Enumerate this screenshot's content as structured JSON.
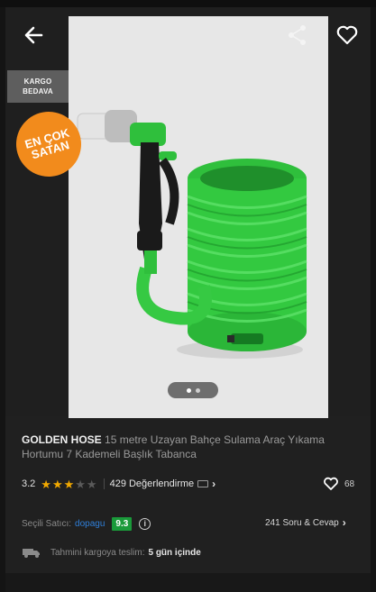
{
  "badges": {
    "kargo_line1": "KARGO",
    "kargo_line2": "BEDAVA",
    "bestseller_line1": "EN ÇOK",
    "bestseller_line2": "SATAN"
  },
  "gallery": {
    "page_count": 2,
    "active_index": 0
  },
  "product": {
    "brand": "GOLDEN HOSE",
    "name": "15 metre Uzayan Bahçe Sulama Araç Yıkama Hortumu 7 Kademeli Başlık Tabanca"
  },
  "rating": {
    "score": "3.2",
    "stars_filled": 3,
    "stars_total": 5,
    "reviews_label": "429 Değerlendirme"
  },
  "favorites": {
    "count": "68"
  },
  "seller": {
    "label": "Seçili Satıcı:",
    "name": "dopagu",
    "score": "9.3"
  },
  "qa": {
    "label": "241 Soru & Cevap"
  },
  "shipping": {
    "label": "Tahmini kargoya teslim:",
    "value": "5 gün içinde"
  },
  "colors": {
    "background": "#141414",
    "accent_orange": "#f28b1c",
    "star": "#f2a900",
    "seller_link": "#2f7fd9",
    "seller_score_bg": "#1a9a3a",
    "hose_green": "#3fd24a"
  }
}
